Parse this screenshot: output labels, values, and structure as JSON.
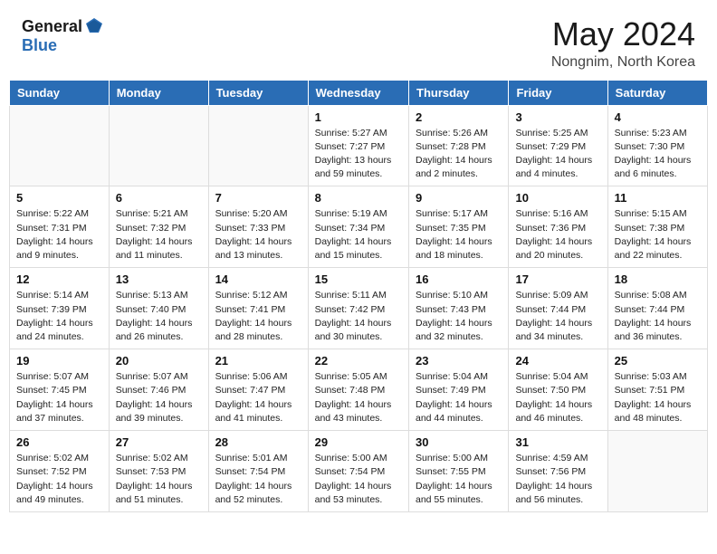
{
  "header": {
    "logo_general": "General",
    "logo_blue": "Blue",
    "month": "May 2024",
    "location": "Nongnim, North Korea"
  },
  "weekdays": [
    "Sunday",
    "Monday",
    "Tuesday",
    "Wednesday",
    "Thursday",
    "Friday",
    "Saturday"
  ],
  "weeks": [
    [
      {
        "day": "",
        "info": ""
      },
      {
        "day": "",
        "info": ""
      },
      {
        "day": "",
        "info": ""
      },
      {
        "day": "1",
        "info": "Sunrise: 5:27 AM\nSunset: 7:27 PM\nDaylight: 13 hours and 59 minutes."
      },
      {
        "day": "2",
        "info": "Sunrise: 5:26 AM\nSunset: 7:28 PM\nDaylight: 14 hours and 2 minutes."
      },
      {
        "day": "3",
        "info": "Sunrise: 5:25 AM\nSunset: 7:29 PM\nDaylight: 14 hours and 4 minutes."
      },
      {
        "day": "4",
        "info": "Sunrise: 5:23 AM\nSunset: 7:30 PM\nDaylight: 14 hours and 6 minutes."
      }
    ],
    [
      {
        "day": "5",
        "info": "Sunrise: 5:22 AM\nSunset: 7:31 PM\nDaylight: 14 hours and 9 minutes."
      },
      {
        "day": "6",
        "info": "Sunrise: 5:21 AM\nSunset: 7:32 PM\nDaylight: 14 hours and 11 minutes."
      },
      {
        "day": "7",
        "info": "Sunrise: 5:20 AM\nSunset: 7:33 PM\nDaylight: 14 hours and 13 minutes."
      },
      {
        "day": "8",
        "info": "Sunrise: 5:19 AM\nSunset: 7:34 PM\nDaylight: 14 hours and 15 minutes."
      },
      {
        "day": "9",
        "info": "Sunrise: 5:17 AM\nSunset: 7:35 PM\nDaylight: 14 hours and 18 minutes."
      },
      {
        "day": "10",
        "info": "Sunrise: 5:16 AM\nSunset: 7:36 PM\nDaylight: 14 hours and 20 minutes."
      },
      {
        "day": "11",
        "info": "Sunrise: 5:15 AM\nSunset: 7:38 PM\nDaylight: 14 hours and 22 minutes."
      }
    ],
    [
      {
        "day": "12",
        "info": "Sunrise: 5:14 AM\nSunset: 7:39 PM\nDaylight: 14 hours and 24 minutes."
      },
      {
        "day": "13",
        "info": "Sunrise: 5:13 AM\nSunset: 7:40 PM\nDaylight: 14 hours and 26 minutes."
      },
      {
        "day": "14",
        "info": "Sunrise: 5:12 AM\nSunset: 7:41 PM\nDaylight: 14 hours and 28 minutes."
      },
      {
        "day": "15",
        "info": "Sunrise: 5:11 AM\nSunset: 7:42 PM\nDaylight: 14 hours and 30 minutes."
      },
      {
        "day": "16",
        "info": "Sunrise: 5:10 AM\nSunset: 7:43 PM\nDaylight: 14 hours and 32 minutes."
      },
      {
        "day": "17",
        "info": "Sunrise: 5:09 AM\nSunset: 7:44 PM\nDaylight: 14 hours and 34 minutes."
      },
      {
        "day": "18",
        "info": "Sunrise: 5:08 AM\nSunset: 7:44 PM\nDaylight: 14 hours and 36 minutes."
      }
    ],
    [
      {
        "day": "19",
        "info": "Sunrise: 5:07 AM\nSunset: 7:45 PM\nDaylight: 14 hours and 37 minutes."
      },
      {
        "day": "20",
        "info": "Sunrise: 5:07 AM\nSunset: 7:46 PM\nDaylight: 14 hours and 39 minutes."
      },
      {
        "day": "21",
        "info": "Sunrise: 5:06 AM\nSunset: 7:47 PM\nDaylight: 14 hours and 41 minutes."
      },
      {
        "day": "22",
        "info": "Sunrise: 5:05 AM\nSunset: 7:48 PM\nDaylight: 14 hours and 43 minutes."
      },
      {
        "day": "23",
        "info": "Sunrise: 5:04 AM\nSunset: 7:49 PM\nDaylight: 14 hours and 44 minutes."
      },
      {
        "day": "24",
        "info": "Sunrise: 5:04 AM\nSunset: 7:50 PM\nDaylight: 14 hours and 46 minutes."
      },
      {
        "day": "25",
        "info": "Sunrise: 5:03 AM\nSunset: 7:51 PM\nDaylight: 14 hours and 48 minutes."
      }
    ],
    [
      {
        "day": "26",
        "info": "Sunrise: 5:02 AM\nSunset: 7:52 PM\nDaylight: 14 hours and 49 minutes."
      },
      {
        "day": "27",
        "info": "Sunrise: 5:02 AM\nSunset: 7:53 PM\nDaylight: 14 hours and 51 minutes."
      },
      {
        "day": "28",
        "info": "Sunrise: 5:01 AM\nSunset: 7:54 PM\nDaylight: 14 hours and 52 minutes."
      },
      {
        "day": "29",
        "info": "Sunrise: 5:00 AM\nSunset: 7:54 PM\nDaylight: 14 hours and 53 minutes."
      },
      {
        "day": "30",
        "info": "Sunrise: 5:00 AM\nSunset: 7:55 PM\nDaylight: 14 hours and 55 minutes."
      },
      {
        "day": "31",
        "info": "Sunrise: 4:59 AM\nSunset: 7:56 PM\nDaylight: 14 hours and 56 minutes."
      },
      {
        "day": "",
        "info": ""
      }
    ]
  ]
}
